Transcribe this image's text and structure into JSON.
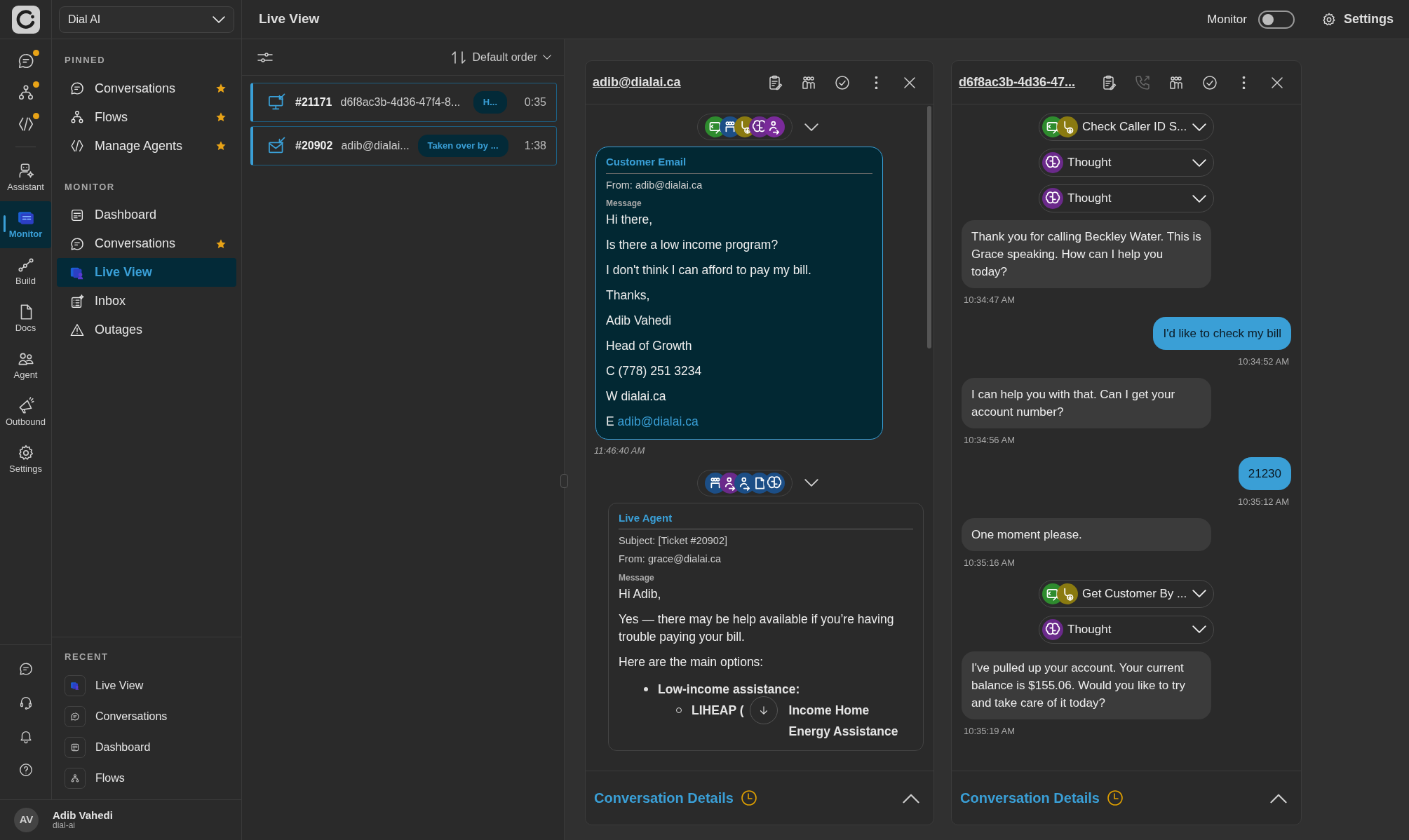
{
  "rail": {
    "top_items": [
      {
        "kind": "chat",
        "dot": true
      },
      {
        "kind": "flow",
        "dot": true
      },
      {
        "kind": "agents",
        "dot": true
      }
    ],
    "items": [
      {
        "kind": "assistant",
        "label": "Assistant",
        "selected": false
      },
      {
        "kind": "monitor",
        "label": "Monitor",
        "selected": true
      },
      {
        "kind": "build",
        "label": "Build",
        "selected": false
      },
      {
        "kind": "docs",
        "label": "Docs",
        "selected": false
      },
      {
        "kind": "agent",
        "label": "Agent",
        "selected": false
      },
      {
        "kind": "outbound",
        "label": "Outbound",
        "selected": false
      },
      {
        "kind": "settings",
        "label": "Settings",
        "selected": false
      }
    ],
    "bottom_items": [
      {
        "kind": "chat"
      },
      {
        "kind": "headset"
      },
      {
        "kind": "bell"
      },
      {
        "kind": "help"
      }
    ]
  },
  "workspace": {
    "value": "Dial AI"
  },
  "sidebar": {
    "sections": [
      {
        "title": "PINNED",
        "items": [
          {
            "kind": "chat",
            "label": "Conversations",
            "starred": true,
            "selected": false
          },
          {
            "kind": "flow",
            "label": "Flows",
            "starred": true,
            "selected": false
          },
          {
            "kind": "agents",
            "label": "Manage Agents",
            "starred": true,
            "selected": false
          }
        ]
      },
      {
        "title": "MONITOR",
        "items": [
          {
            "kind": "dashboard",
            "label": "Dashboard",
            "starred": false,
            "selected": false
          },
          {
            "kind": "chat",
            "label": "Conversations",
            "starred": true,
            "selected": false
          },
          {
            "kind": "liveview",
            "label": "Live View",
            "starred": false,
            "selected": true
          },
          {
            "kind": "inbox",
            "label": "Inbox",
            "starred": false,
            "selected": false
          },
          {
            "kind": "outages",
            "label": "Outages",
            "starred": false,
            "selected": false
          }
        ]
      }
    ],
    "recent": {
      "title": "RECENT",
      "items": [
        {
          "kind": "liveview",
          "label": "Live View"
        },
        {
          "kind": "chat",
          "label": "Conversations"
        },
        {
          "kind": "dashboard",
          "label": "Dashboard"
        },
        {
          "kind": "flow",
          "label": "Flows"
        }
      ]
    }
  },
  "user": {
    "initials": "AV",
    "name": "Adib Vahedi",
    "org": "dial-ai"
  },
  "header": {
    "title": "Live View",
    "monitor_label": "Monitor",
    "monitor_on": false,
    "settings_label": "Settings"
  },
  "list": {
    "sort_label": "Default order",
    "items": [
      {
        "kind": "desktop",
        "number": "#21171",
        "name": "d6f8ac3b-4d36-47f4-8...",
        "status": "H...",
        "time": "0:35"
      },
      {
        "kind": "email",
        "number": "#20902",
        "name": "adib@dialai...",
        "status": "Taken over by ...",
        "time": "1:38"
      }
    ]
  },
  "panels": [
    {
      "title": "adib@dialai.ca",
      "actions": [
        {
          "kind": "notes",
          "disabled": false
        },
        {
          "kind": "agents",
          "disabled": false
        },
        {
          "kind": "resolve",
          "disabled": false
        },
        {
          "kind": "more",
          "disabled": false
        },
        {
          "kind": "close",
          "disabled": false
        }
      ],
      "events": [
        {
          "kind": "steps",
          "icons": [
            {
              "kind": "tool",
              "color": "#2e8b2e"
            },
            {
              "kind": "agents",
              "color": "#1c4e86"
            },
            {
              "kind": "download",
              "color": "#8a7a10"
            },
            {
              "kind": "thought",
              "color": "#6a2a8a"
            },
            {
              "kind": "handoff",
              "color": "#7a2a9a"
            }
          ]
        },
        {
          "kind": "email",
          "heading": "Customer Email",
          "highlight": true,
          "fields": [
            "From: adib@dialai.ca"
          ],
          "message_label": "Message",
          "paragraphs": [
            {
              "text": "Hi there,"
            },
            {
              "text": "Is there a low income program?"
            },
            {
              "text": "I don't think I can afford to pay my bill."
            },
            {
              "text": "Thanks,"
            },
            {
              "text": "Adib Vahedi"
            },
            {
              "text": "Head of Growth"
            },
            {
              "text": "C (778) 251 3234"
            },
            {
              "text": "W dialai.ca"
            },
            {
              "text": "E",
              "link": "adib@dialai.ca"
            }
          ],
          "time": "11:46:40 AM"
        },
        {
          "kind": "steps",
          "icons": [
            {
              "kind": "agents",
              "color": "#1c4e86"
            },
            {
              "kind": "handoff",
              "color": "#6a2a8a"
            },
            {
              "kind": "handoff",
              "color": "#1c4e86"
            },
            {
              "kind": "document",
              "color": "#1c4e86"
            },
            {
              "kind": "thought",
              "color": "#1c4e86"
            }
          ]
        },
        {
          "kind": "email",
          "heading": "Live Agent",
          "highlight": false,
          "fields": [
            "Subject: [Ticket #20902]",
            "From: grace@dialai.ca"
          ],
          "message_label": "Message",
          "paragraphs": [
            {
              "text": "Hi Adib,"
            },
            {
              "text": "Yes — there may be help available if you’re having trouble paying your bill."
            },
            {
              "text": "Here are the main options:"
            }
          ],
          "bullets": [
            {
              "parts": [
                "Low-income assistance:"
              ],
              "children": [
                {
                  "parts": [
                    "LIHEAP (",
                    "Income Home Energy Assistance"
                  ]
                }
              ]
            }
          ]
        }
      ],
      "footer": "Conversation Details"
    },
    {
      "title": "d6f8ac3b-4d36-47...",
      "actions": [
        {
          "kind": "notes",
          "disabled": false
        },
        {
          "kind": "transfer",
          "disabled": true
        },
        {
          "kind": "agents",
          "disabled": false
        },
        {
          "kind": "resolve",
          "disabled": false
        },
        {
          "kind": "more",
          "disabled": false
        },
        {
          "kind": "close",
          "disabled": false
        }
      ],
      "events": [
        {
          "kind": "tool",
          "label": "Check Caller ID S...",
          "icons": [
            {
              "kind": "tool",
              "color": "#2e8b2e"
            },
            {
              "kind": "download",
              "color": "#8a7a10"
            }
          ]
        },
        {
          "kind": "tool",
          "label": "Thought",
          "icons": [
            {
              "kind": "thought",
              "color": "#6a2a8a"
            }
          ]
        },
        {
          "kind": "tool",
          "label": "Thought",
          "icons": [
            {
              "kind": "thought",
              "color": "#6a2a8a"
            }
          ]
        },
        {
          "kind": "agent_message",
          "text": "Thank you for calling Beckley Water. This is Grace speaking. How can I help you today?",
          "time": "10:34:47 AM"
        },
        {
          "kind": "user_message",
          "text": "I'd like to check my bill",
          "time": "10:34:52 AM"
        },
        {
          "kind": "agent_message",
          "text": "I can help you with that. Can I get your account number?",
          "time": "10:34:56 AM"
        },
        {
          "kind": "user_message",
          "text": "21230",
          "time": "10:35:12 AM"
        },
        {
          "kind": "agent_message",
          "text": "One moment please.",
          "time": "10:35:16 AM"
        },
        {
          "kind": "tool",
          "label": "Get Customer By ...",
          "icons": [
            {
              "kind": "tool",
              "color": "#2e8b2e"
            },
            {
              "kind": "download",
              "color": "#8a7a10"
            }
          ]
        },
        {
          "kind": "tool",
          "label": "Thought",
          "icons": [
            {
              "kind": "thought",
              "color": "#6a2a8a"
            }
          ]
        },
        {
          "kind": "agent_message",
          "text": "I've pulled up your account. Your current balance is $155.06. Would you like to try and take care of it today?",
          "time": "10:35:19 AM"
        }
      ],
      "footer": "Conversation Details"
    }
  ]
}
